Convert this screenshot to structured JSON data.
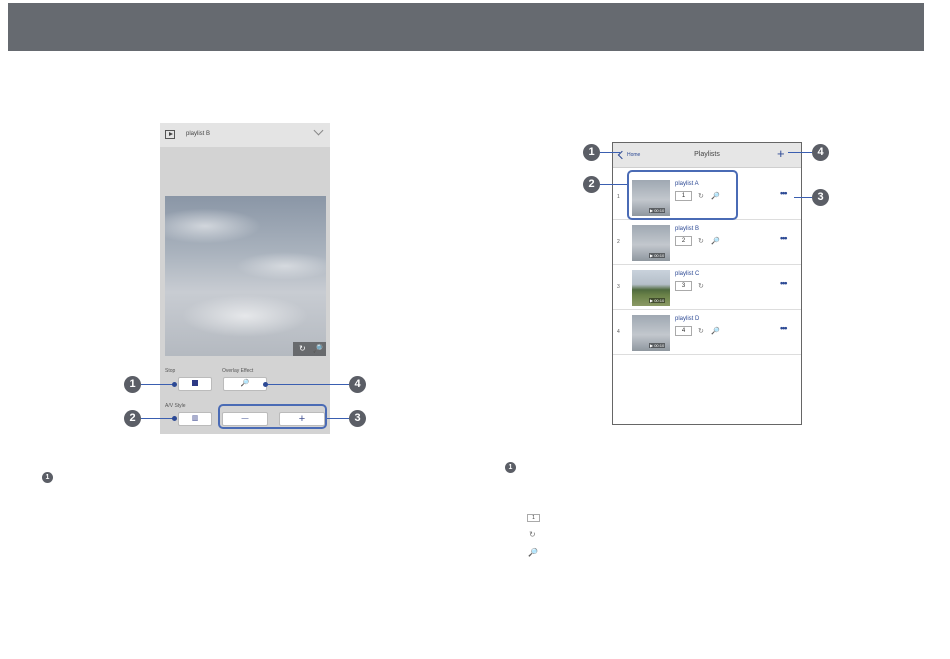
{
  "callouts": [
    "1",
    "2",
    "3",
    "4"
  ],
  "left_screen": {
    "header_icon": "play-box-icon",
    "playlist_name": "playlist B",
    "header_chevron": "chevron-down-icon",
    "image_controls": {
      "repeat_icon": "↻",
      "effect_icon": "🔎"
    },
    "stop_label": "Stop",
    "overlay_label": "Overlay Effect",
    "aspect_label": "A/V Style",
    "overlay_button_icon": "magic-wand-icon",
    "aspect_button_icon": "aspect-ratio-icon",
    "minus_label": "—",
    "plus_label": "+"
  },
  "right_screen": {
    "back_label": "Home",
    "title": "Playlists",
    "add_label": "+",
    "more_label": "•••",
    "rows": [
      {
        "number": "1",
        "name": "playlist A",
        "count": "1",
        "duration": "▶ 00:10",
        "repeat": "↻",
        "effect": "🔎",
        "thumb": "gray"
      },
      {
        "number": "2",
        "name": "playlist B",
        "count": "2",
        "duration": "▶ 00:10",
        "repeat": "↻",
        "effect": "🔎",
        "thumb": "gray"
      },
      {
        "number": "3",
        "name": "playlist C",
        "count": "3",
        "duration": "▶ 00:10",
        "repeat": "↻",
        "effect": "",
        "thumb": "green"
      },
      {
        "number": "4",
        "name": "playlist D",
        "count": "4",
        "duration": "▶ 00:10",
        "repeat": "↻",
        "effect": "🔎",
        "thumb": "gray"
      }
    ]
  },
  "legend": {
    "count_sample": "1",
    "repeat_icon": "↻",
    "effect_icon": "🔎"
  },
  "colors": {
    "accent": "#2d4a95",
    "outline": "#4a6bb5",
    "callout": "#5b5e66",
    "top_bar": "#666a70"
  }
}
